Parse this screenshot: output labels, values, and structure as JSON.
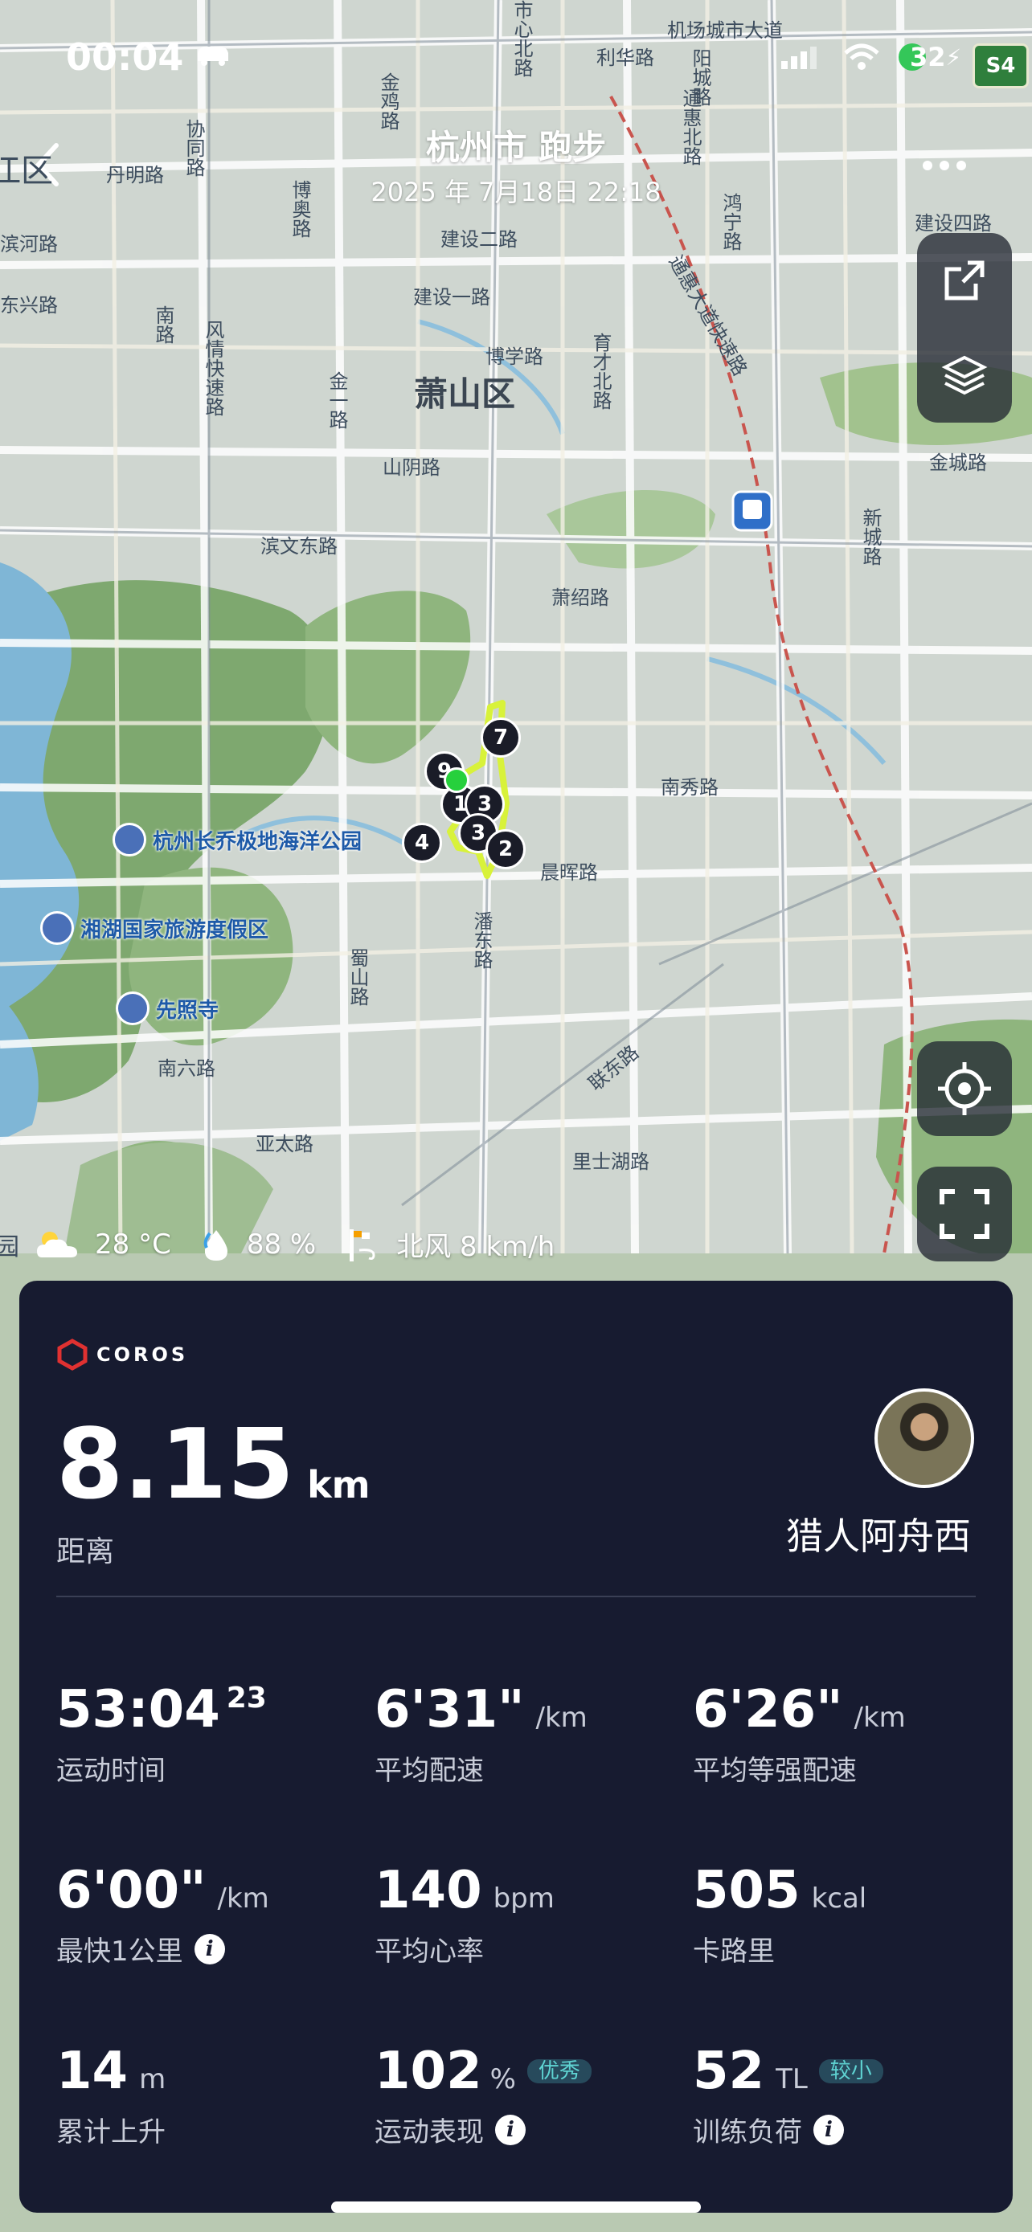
{
  "status": {
    "time": "00:04",
    "battery": "32"
  },
  "header": {
    "title": "杭州市 跑步",
    "subtitle": "2025 年 7月18日 22:18",
    "left_partial": "江区"
  },
  "map": {
    "district": "萧山区",
    "road_labels": [
      "机场城市大道",
      "利华路",
      "金鸡路",
      "阳城路",
      "博奥路",
      "协同路",
      "丹明路",
      "建设二路",
      "建设一路",
      "建设四路",
      "博学路",
      "育才北路",
      "金一路",
      "山阴路",
      "滨文东路",
      "萧绍路",
      "南秀路",
      "晨晖路",
      "蜀山路",
      "潘东路",
      "联东路",
      "里士湖路",
      "南六路",
      "亚太路",
      "金城路",
      "新城路",
      "市心北路",
      "通惠北路",
      "鸿宁路",
      "风情快速路",
      "滨河路",
      "东兴路",
      "南路",
      "通惠大道快速路"
    ],
    "pois": [
      "杭州长乔极地海洋公园",
      "湘湖国家旅游度假区",
      "先照寺"
    ],
    "markers": [
      "7",
      "9",
      "1",
      "3",
      "3",
      "4",
      "2"
    ],
    "highway_badge": "S4"
  },
  "weather": {
    "partial": "园",
    "temp": "28 °C",
    "humidity": "88 %",
    "wind": "北风 8 km/h"
  },
  "card": {
    "brand": "COROS",
    "distance": {
      "value": "8.15",
      "unit": "km",
      "label": "距离"
    },
    "user": "猎人阿舟西",
    "stats": [
      {
        "value": "53:04",
        "sup": "23",
        "unit": "",
        "label": "运动时间"
      },
      {
        "value": "6'31\"",
        "unit": "/km",
        "label": "平均配速"
      },
      {
        "value": "6'26\"",
        "unit": "/km",
        "label": "平均等强配速"
      },
      {
        "value": "6'00\"",
        "unit": "/km",
        "label": "最快1公里",
        "info": true
      },
      {
        "value": "140",
        "unit": "bpm",
        "label": "平均心率"
      },
      {
        "value": "505",
        "unit": "kcal",
        "label": "卡路里"
      },
      {
        "value": "14",
        "unit": "m",
        "label": "累计上升"
      },
      {
        "value": "102",
        "unit": "%",
        "label": "运动表现",
        "badge": "优秀",
        "info": true
      },
      {
        "value": "52",
        "unit": "TL",
        "label": "训练负荷",
        "badge": "较小",
        "info": true
      }
    ]
  },
  "colors": {
    "card_bg": "#171b30",
    "route": "#d8f23a",
    "badge_text": "#5fd3d2"
  }
}
